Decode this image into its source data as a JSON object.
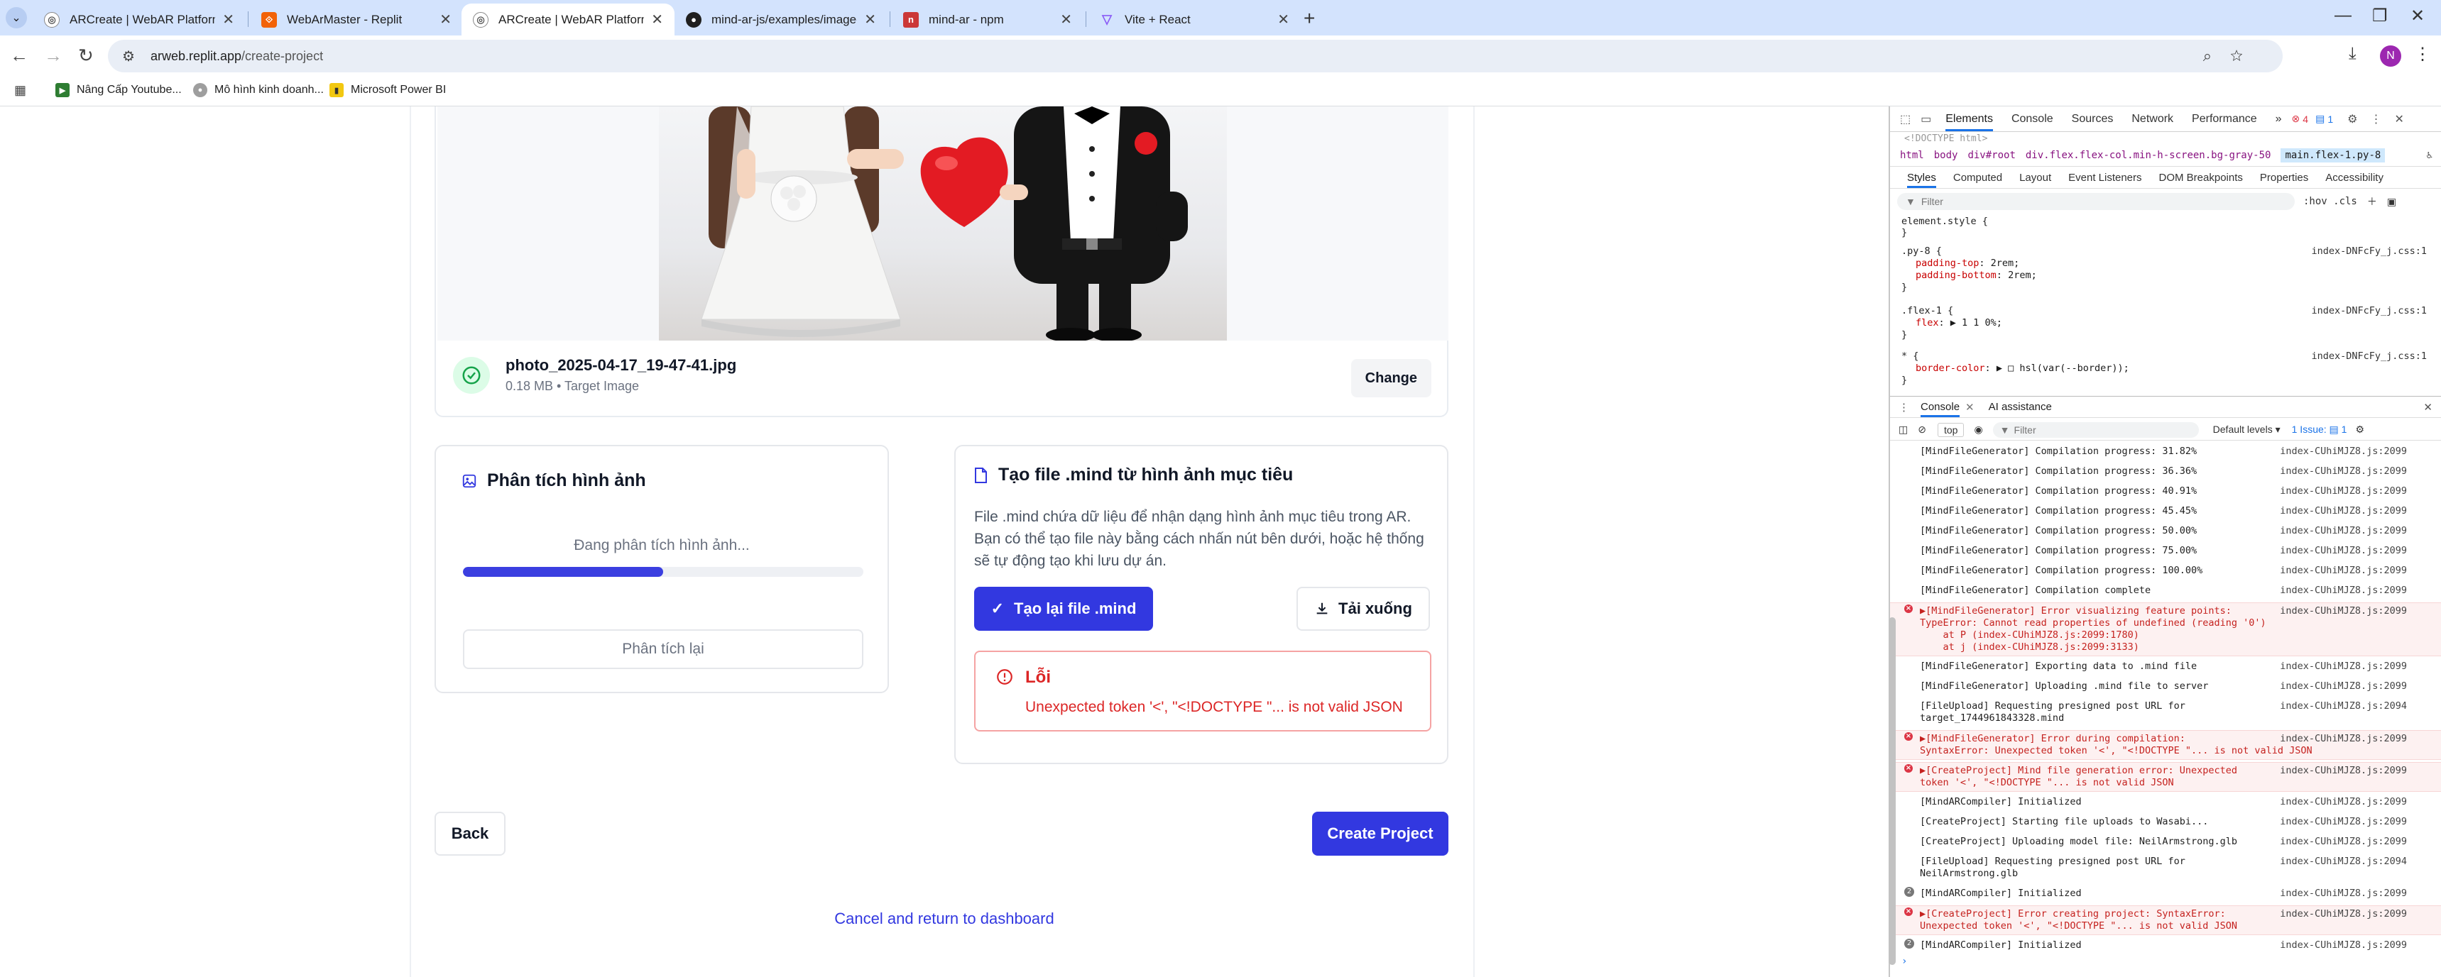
{
  "browser": {
    "tabs": [
      {
        "title": "ARCreate | WebAR Platform",
        "active": false
      },
      {
        "title": "WebArMaster - Replit",
        "active": false
      },
      {
        "title": "ARCreate | WebAR Platform",
        "active": true
      },
      {
        "title": "mind-ar-js/examples/image-tra",
        "active": false
      },
      {
        "title": "mind-ar - npm",
        "active": false
      },
      {
        "title": "Vite + React",
        "active": false
      }
    ],
    "url_host": "arweb.replit.app",
    "url_path": "/create-project",
    "avatar_letter": "N",
    "bookmarks": [
      "Nâng Cấp Youtube...",
      "Mô hình kinh doanh...",
      "Microsoft Power BI"
    ]
  },
  "image_card": {
    "file_name": "photo_2025-04-17_19-47-41.jpg",
    "file_meta": "0.18 MB • Target Image",
    "change_label": "Change"
  },
  "analysis": {
    "title": "Phân tích hình ảnh",
    "status": "Đang phân tích hình ảnh...",
    "progress_fraction": 0.5,
    "retry_label": "Phân tích lại"
  },
  "mind": {
    "title": "Tạo file .mind từ hình ảnh mục tiêu",
    "description": "File .mind chứa dữ liệu để nhận dạng hình ảnh mục tiêu trong AR. Bạn có thể tạo file này bằng cách nhấn nút bên dưới, hoặc hệ thống sẽ tự động tạo khi lưu dự án.",
    "regenerate_label": "Tạo lại file .mind",
    "download_label": "Tải xuống",
    "error_title": "Lỗi",
    "error_message": "Unexpected token '<', \"<!DOCTYPE \"... is not valid JSON"
  },
  "footer": {
    "back_label": "Back",
    "create_label": "Create Project",
    "cancel_label": "Cancel and return to dashboard"
  },
  "devtools": {
    "tabs": [
      "Elements",
      "Console",
      "Sources",
      "Network",
      "Performance",
      "»"
    ],
    "error_count": "4",
    "msg_count": "1",
    "doctype_snippet": "<!DOCTYPE html>",
    "breadcrumbs": [
      "html",
      "body",
      "div#root",
      "div.flex.flex-col.min-h-screen.bg-gray-50",
      "main.flex-1.py-8"
    ],
    "subtabs": [
      "Styles",
      "Computed",
      "Layout",
      "Event Listeners",
      "DOM Breakpoints",
      "Properties",
      "Accessibility"
    ],
    "filter_placeholder": "Filter",
    "filter_opts": ":hov .cls",
    "css_file": "index-DNFcFy_j.css:1",
    "css_rules": [
      {
        "sel": "element.style {",
        "file": ""
      },
      {
        "sel": ".py-8 {",
        "file": "index-DNFcFy_j.css:1",
        "props": [
          [
            "padding-top",
            "2rem;"
          ],
          [
            "padding-bottom",
            "2rem;"
          ]
        ]
      },
      {
        "sel": ".flex-1 {",
        "file": "index-DNFcFy_j.css:1",
        "props": [
          [
            "flex",
            "▶ 1 1 0%;"
          ]
        ]
      },
      {
        "sel": "* {",
        "file": "index-DNFcFy_j.css:1",
        "props": [
          [
            "border-color",
            "▶ □ hsl(var(--border));"
          ]
        ]
      }
    ],
    "drawer_tabs": [
      "Console",
      "AI assistance"
    ],
    "context": "top",
    "levels": "Default levels ▾",
    "issues": "1 Issue: ▤ 1",
    "console_filter": "Filter",
    "logs": [
      {
        "t": "log",
        "msg": "[MindFileGenerator] Compilation progress: 31.82%",
        "src": "index-CUhiMJZ8.js:2099"
      },
      {
        "t": "log",
        "msg": "[MindFileGenerator] Compilation progress: 36.36%",
        "src": "index-CUhiMJZ8.js:2099"
      },
      {
        "t": "log",
        "msg": "[MindFileGenerator] Compilation progress: 40.91%",
        "src": "index-CUhiMJZ8.js:2099"
      },
      {
        "t": "log",
        "msg": "[MindFileGenerator] Compilation progress: 45.45%",
        "src": "index-CUhiMJZ8.js:2099"
      },
      {
        "t": "log",
        "msg": "[MindFileGenerator] Compilation progress: 50.00%",
        "src": "index-CUhiMJZ8.js:2099"
      },
      {
        "t": "log",
        "msg": "[MindFileGenerator] Compilation progress: 75.00%",
        "src": "index-CUhiMJZ8.js:2099"
      },
      {
        "t": "log",
        "msg": "[MindFileGenerator] Compilation progress: 100.00%",
        "src": "index-CUhiMJZ8.js:2099"
      },
      {
        "t": "log",
        "msg": "[MindFileGenerator] Compilation complete",
        "src": "index-CUhiMJZ8.js:2099"
      },
      {
        "t": "err",
        "msg": "▶[MindFileGenerator] Error visualizing feature points:\nTypeError: Cannot read properties of undefined (reading '0')\n    at P (index-CUhiMJZ8.js:2099:1780)\n    at j (index-CUhiMJZ8.js:2099:3133)",
        "src": "index-CUhiMJZ8.js:2099"
      },
      {
        "t": "log",
        "msg": "[MindFileGenerator] Exporting data to .mind file",
        "src": "index-CUhiMJZ8.js:2099"
      },
      {
        "t": "log",
        "msg": "[MindFileGenerator] Uploading .mind file to server",
        "src": "index-CUhiMJZ8.js:2099"
      },
      {
        "t": "log",
        "msg": "[FileUpload] Requesting presigned post URL for\ntarget_1744961843328.mind",
        "src": "index-CUhiMJZ8.js:2094"
      },
      {
        "t": "err",
        "msg": "▶[MindFileGenerator] Error during compilation:\nSyntaxError: Unexpected token '<', \"<!DOCTYPE \"... is not valid JSON",
        "src": "index-CUhiMJZ8.js:2099"
      },
      {
        "t": "err",
        "msg": "▶[CreateProject] Mind file generation error: Unexpected\ntoken '<', \"<!DOCTYPE \"... is not valid JSON",
        "src": "index-CUhiMJZ8.js:2099"
      },
      {
        "t": "log",
        "msg": "[MindARCompiler] Initialized",
        "src": "index-CUhiMJZ8.js:2099"
      },
      {
        "t": "log",
        "msg": "[CreateProject] Starting file uploads to Wasabi...",
        "src": "index-CUhiMJZ8.js:2099"
      },
      {
        "t": "log",
        "msg": "[CreateProject] Uploading model file: NeilArmstrong.glb",
        "src": "index-CUhiMJZ8.js:2099"
      },
      {
        "t": "log",
        "msg": "[FileUpload] Requesting presigned post URL for\nNeilArmstrong.glb",
        "src": "index-CUhiMJZ8.js:2094"
      },
      {
        "t": "cnt",
        "count": "2",
        "msg": "[MindARCompiler] Initialized",
        "src": "index-CUhiMJZ8.js:2099"
      },
      {
        "t": "err",
        "msg": "▶[CreateProject] Error creating project: SyntaxError:\nUnexpected token '<', \"<!DOCTYPE \"... is not valid JSON",
        "src": "index-CUhiMJZ8.js:2099"
      },
      {
        "t": "cnt",
        "count": "2",
        "msg": "[MindARCompiler] Initialized",
        "src": "index-CUhiMJZ8.js:2099"
      }
    ]
  }
}
